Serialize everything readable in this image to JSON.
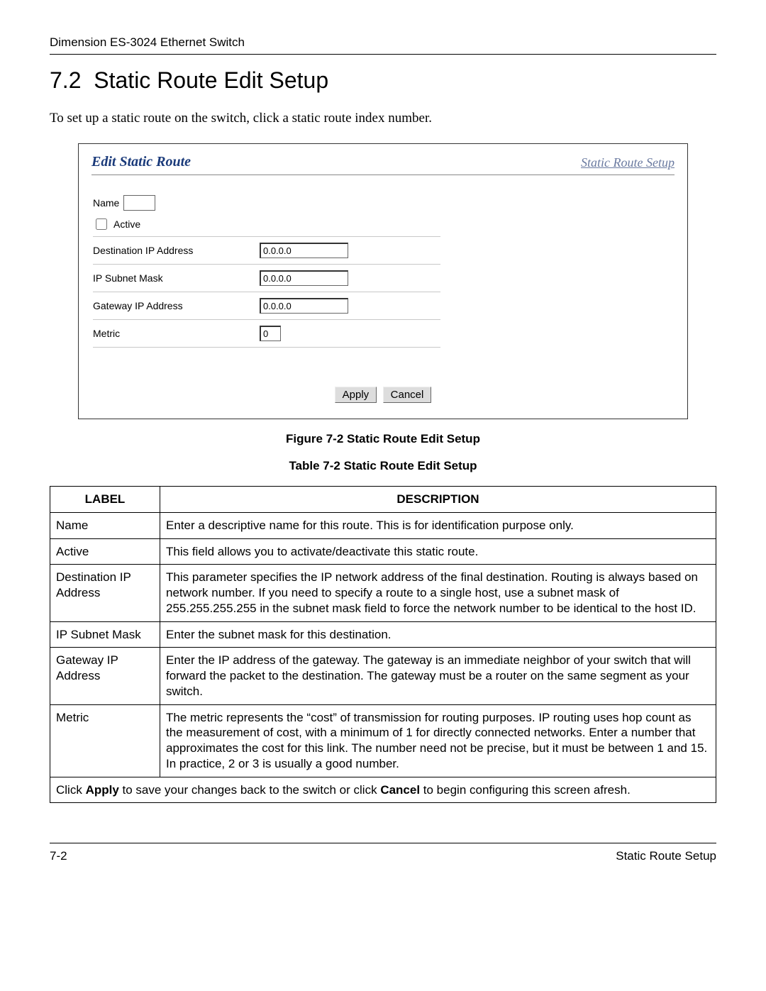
{
  "header": {
    "running_head": "Dimension ES-3024 Ethernet Switch",
    "section_number": "7.2",
    "section_title": "Static Route Edit Setup",
    "intro": "To set up a static route on the switch, click a static route index number."
  },
  "screenshot": {
    "title": "Edit Static Route",
    "link": "Static Route Setup",
    "name_label": "Name",
    "name_value": "",
    "active_label": "Active",
    "active_checked": false,
    "rows": [
      {
        "label": "Destination IP Address",
        "value": "0.0.0.0"
      },
      {
        "label": "IP Subnet Mask",
        "value": "0.0.0.0"
      },
      {
        "label": "Gateway IP Address",
        "value": "0.0.0.0"
      },
      {
        "label": "Metric",
        "value": "0"
      }
    ],
    "buttons": {
      "apply": "Apply",
      "cancel": "Cancel"
    }
  },
  "figure_caption": "Figure 7-2 Static Route Edit Setup",
  "table_caption": "Table 7-2 Static Route Edit Setup",
  "table": {
    "head_label": "LABEL",
    "head_desc": "DESCRIPTION",
    "rows": [
      {
        "label": "Name",
        "desc": "Enter a descriptive name for this route. This is for identification purpose only."
      },
      {
        "label": "Active",
        "desc": "This field allows you to activate/deactivate this static route."
      },
      {
        "label": "Destination IP Address",
        "desc": "This parameter specifies the IP network address of the final destination. Routing is always based on network number. If you need to specify a route to a single host, use a subnet mask of 255.255.255.255 in the subnet mask field to force the network number to be identical to the host ID."
      },
      {
        "label": "IP Subnet Mask",
        "desc": "Enter the subnet mask for this destination."
      },
      {
        "label": "Gateway IP Address",
        "desc": "Enter the IP address of the gateway. The gateway is an immediate neighbor of your switch that will forward the packet to the destination. The gateway must be a router on the same segment as your switch."
      },
      {
        "label": "Metric",
        "desc": "The metric represents the “cost” of transmission for routing purposes. IP routing uses hop count as the measurement of cost, with a minimum of 1 for directly connected networks. Enter a number that approximates the cost for this link. The number need not be precise, but it must be between 1 and 15. In practice, 2 or 3 is usually a good number."
      }
    ],
    "footer_pre": "Click ",
    "footer_apply": "Apply",
    "footer_mid": " to save your changes back to the switch or click ",
    "footer_cancel": "Cancel",
    "footer_post": " to begin configuring this screen afresh."
  },
  "footer": {
    "page_num": "7-2",
    "section_name": "Static Route Setup"
  }
}
